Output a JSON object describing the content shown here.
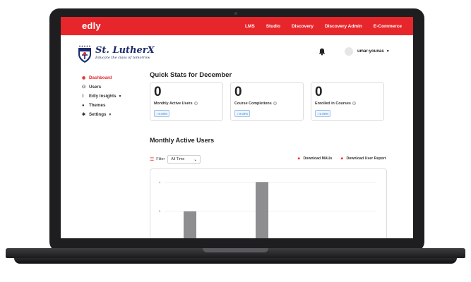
{
  "topbar": {
    "brand": "edly",
    "nav": [
      "LMS",
      "Studio",
      "Discovery",
      "Discovery Admin",
      "E-Commerce"
    ]
  },
  "header": {
    "logo_title": "St. LutherX",
    "logo_tagline": "Educate the class of tomorrow",
    "username": "umar-younas"
  },
  "sidebar": {
    "items": [
      {
        "label": "Dashboard",
        "icon": "dashboard-icon",
        "active": true
      },
      {
        "label": "Users",
        "icon": "users-icon"
      },
      {
        "label": "Edly Insights",
        "icon": "chart-line-icon",
        "dropdown": true
      },
      {
        "label": "Themes",
        "icon": "palette-icon"
      },
      {
        "label": "Settings",
        "icon": "gear-icon",
        "dropdown": true
      }
    ]
  },
  "stats": {
    "title": "Quick Stats for December",
    "cards": [
      {
        "value": "0",
        "label": "Monthly Active Users",
        "change": "0.00%"
      },
      {
        "value": "0",
        "label": "Course Completions",
        "change": "0.00%"
      },
      {
        "value": "0",
        "label": "Enrolled in Courses",
        "change": "0.00%"
      }
    ]
  },
  "mau": {
    "title": "Monthly Active Users",
    "filter_label": "Filter",
    "filter_value": "All Time",
    "download_maus": "Download MAUs",
    "download_user_report": "Download User Report"
  },
  "chart_data": {
    "type": "bar",
    "y_ticks": [
      "4",
      "3",
      "2"
    ],
    "values": [
      3,
      2,
      0,
      2,
      4
    ],
    "ylim": [
      1.3,
      4.2
    ],
    "bar_color": "#8e8e91"
  },
  "colors": {
    "accent": "#e7262b",
    "brand_navy": "#1c2c6e",
    "badge_blue": "#3b86d6"
  }
}
